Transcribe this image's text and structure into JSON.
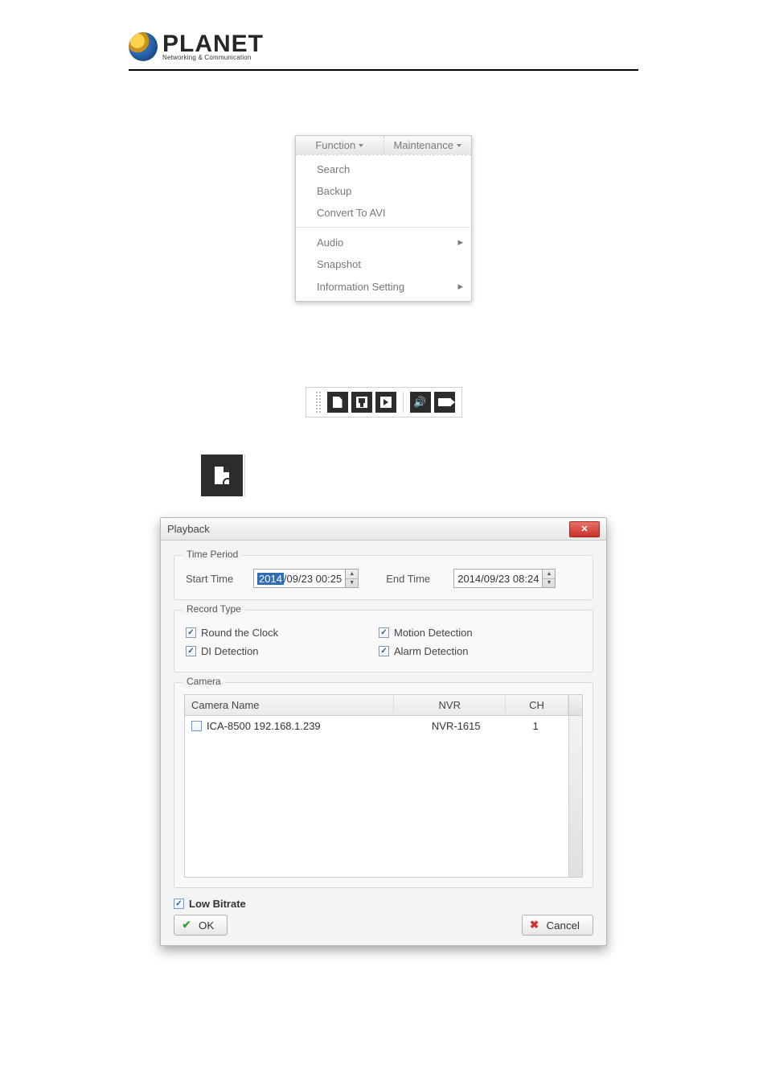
{
  "logo": {
    "brand": "PLANET",
    "tagline": "Networking & Communication"
  },
  "menu_screenshot": {
    "tabs": [
      "Function",
      "Maintenance"
    ],
    "sections": [
      {
        "items": [
          "Search",
          "Backup",
          "Convert To AVI"
        ]
      },
      {
        "items_with_arrow": [
          {
            "label": "Audio",
            "arrow": true
          },
          {
            "label": "Snapshot",
            "arrow": false
          },
          {
            "label": "Information Setting",
            "arrow": true
          }
        ]
      }
    ]
  },
  "toolbar": {
    "icons": [
      "file-search-icon",
      "file-save-icon",
      "file-play-icon",
      "speaker-icon",
      "camera-icon"
    ]
  },
  "big_icon": "file-search-icon",
  "playback_dialog": {
    "title": "Playback",
    "time_period": {
      "legend": "Time Period",
      "start_label": "Start Time",
      "start_value": {
        "selected": "2014",
        "rest": "/09/23 00:25"
      },
      "end_label": "End Time",
      "end_value": "2014/09/23 08:24"
    },
    "record_type": {
      "legend": "Record Type",
      "options": [
        {
          "label": "Round the Clock",
          "checked": true
        },
        {
          "label": "Motion Detection",
          "checked": true
        },
        {
          "label": "DI Detection",
          "checked": true
        },
        {
          "label": "Alarm Detection",
          "checked": true
        }
      ]
    },
    "camera": {
      "legend": "Camera",
      "headers": [
        "Camera Name",
        "NVR",
        "CH"
      ],
      "rows": [
        {
          "checked": false,
          "name": "ICA-8500 192.168.1.239",
          "nvr": "NVR-1615",
          "ch": "1"
        }
      ]
    },
    "low_bitrate": {
      "label": "Low Bitrate",
      "checked": true
    },
    "buttons": {
      "ok": "OK",
      "cancel": "Cancel"
    }
  }
}
